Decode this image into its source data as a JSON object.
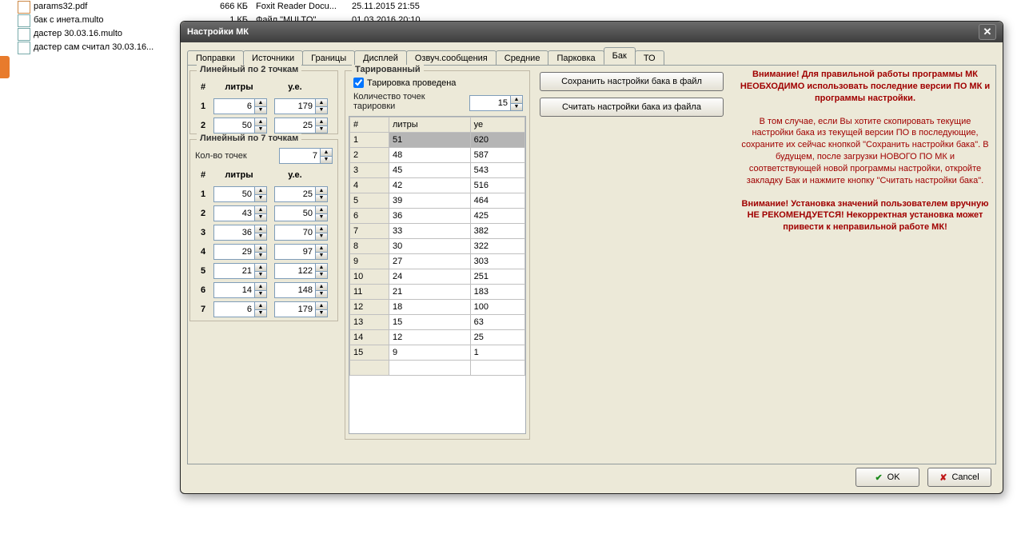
{
  "explorer": {
    "files": [
      {
        "name": "params32.pdf",
        "icon": "pdf",
        "size": "666 КБ",
        "type": "Foxit Reader Docu...",
        "date": "25.11.2015 21:55"
      },
      {
        "name": "бак с инета.multo",
        "icon": "multo",
        "size": "1 КБ",
        "type": "Файл \"MULTO\"",
        "date": "01.03.2016 20:10"
      },
      {
        "name": "дастер 30.03.16.multo",
        "icon": "multo",
        "size": "",
        "type": "",
        "date": ""
      },
      {
        "name": "дастер сам считал 30.03.16...",
        "icon": "multo",
        "size": "",
        "type": "",
        "date": ""
      }
    ]
  },
  "dialog": {
    "title": "Настройки МК",
    "tabs": [
      "Поправки",
      "Источники",
      "Границы",
      "Дисплей",
      "Озвуч.сообщения",
      "Средние",
      "Парковка",
      "Бак",
      "ТО"
    ],
    "active_tab": "Бак",
    "linear2": {
      "legend": "Линейный по 2 точкам",
      "h_num": "#",
      "h_l": "литры",
      "h_u": "у.е.",
      "rows": [
        {
          "n": "1",
          "l": "6",
          "u": "179"
        },
        {
          "n": "2",
          "l": "50",
          "u": "25"
        }
      ]
    },
    "linear7": {
      "legend": "Линейный по 7 точкам",
      "count_label": "Кол-во точек",
      "count": "7",
      "h_num": "#",
      "h_l": "литры",
      "h_u": "у.е.",
      "rows": [
        {
          "n": "1",
          "l": "50",
          "u": "25"
        },
        {
          "n": "2",
          "l": "43",
          "u": "50"
        },
        {
          "n": "3",
          "l": "36",
          "u": "70"
        },
        {
          "n": "4",
          "l": "29",
          "u": "97"
        },
        {
          "n": "5",
          "l": "21",
          "u": "122"
        },
        {
          "n": "6",
          "l": "14",
          "u": "148"
        },
        {
          "n": "7",
          "l": "6",
          "u": "179"
        }
      ]
    },
    "tar": {
      "legend": "Тарированный",
      "done_label": "Тарировка проведена",
      "done": true,
      "count_label": "Количество точек тарировки",
      "count": "15",
      "h_num": "#",
      "h_l": "литры",
      "h_u": "уе",
      "rows": [
        {
          "n": "1",
          "l": "51",
          "u": "620"
        },
        {
          "n": "2",
          "l": "48",
          "u": "587"
        },
        {
          "n": "3",
          "l": "45",
          "u": "543"
        },
        {
          "n": "4",
          "l": "42",
          "u": "516"
        },
        {
          "n": "5",
          "l": "39",
          "u": "464"
        },
        {
          "n": "6",
          "l": "36",
          "u": "425"
        },
        {
          "n": "7",
          "l": "33",
          "u": "382"
        },
        {
          "n": "8",
          "l": "30",
          "u": "322"
        },
        {
          "n": "9",
          "l": "27",
          "u": "303"
        },
        {
          "n": "10",
          "l": "24",
          "u": "251"
        },
        {
          "n": "11",
          "l": "21",
          "u": "183"
        },
        {
          "n": "12",
          "l": "18",
          "u": "100"
        },
        {
          "n": "13",
          "l": "15",
          "u": "63"
        },
        {
          "n": "14",
          "l": "12",
          "u": "25"
        },
        {
          "n": "15",
          "l": "9",
          "u": "1"
        }
      ]
    },
    "right": {
      "save_btn": "Сохранить настройки бака в файл",
      "load_btn": "Считать настройки бака из файла",
      "warn1": "Внимание! Для правильной работы программы МК НЕОБХОДИМО использовать последние версии ПО МК и программы настройки.",
      "info": "В том случае, если Вы хотите скопировать текущие настройки бака из текущей версии ПО в последующие, сохраните их сейчас кнопкой \"Сохранить настройки бака\". В будущем, после загрузки НОВОГО ПО МК и соответствующей новой программы настройки, откройте закладку Бак и нажмите кнопку \"Считать настройки бака\".",
      "warn2": "Внимание! Установка значений пользователем вручную НЕ РЕКОМЕНДУЕТСЯ! Некорректная установка может привести к неправильной работе МК!"
    },
    "ok": "OK",
    "cancel": "Cancel"
  }
}
